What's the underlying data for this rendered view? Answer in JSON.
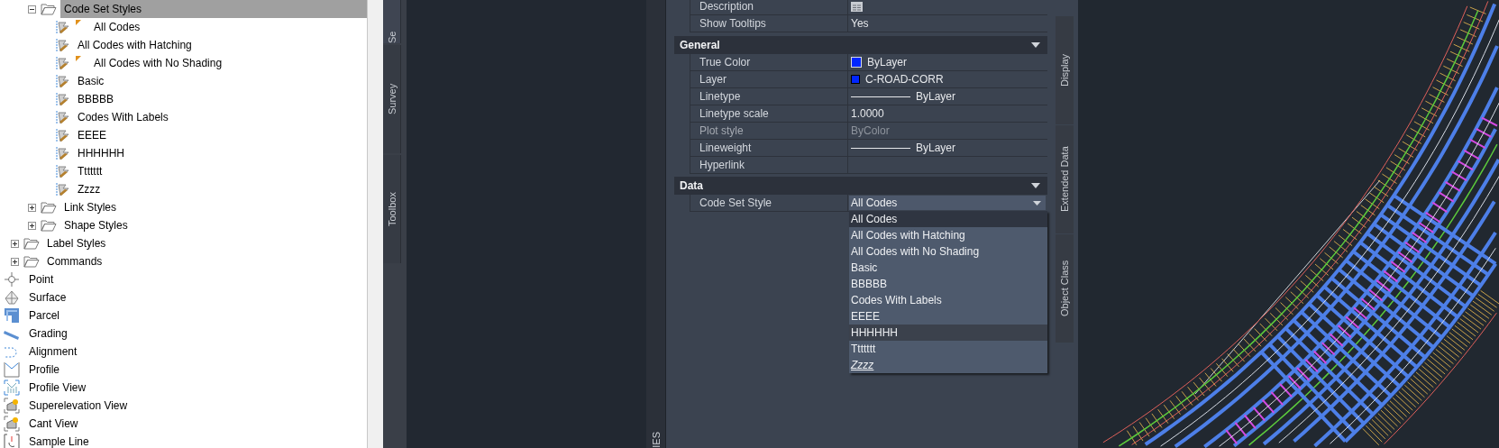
{
  "tree": [
    {
      "children": [
        {
          "children": [
            {
              "label": "Code Set Styles",
              "kind": "folder",
              "expanded": true,
              "selected": true,
              "children": [
                {
                  "label": "All Codes",
                  "kind": "style",
                  "flagged": true,
                  "selected": false
                },
                {
                  "label": "All Codes with Hatching",
                  "kind": "style",
                  "flagged": false,
                  "selected": false
                },
                {
                  "label": "All Codes with No Shading",
                  "kind": "style",
                  "flagged": true,
                  "selected": false
                },
                {
                  "label": "Basic",
                  "kind": "style",
                  "flagged": false,
                  "selected": false
                },
                {
                  "label": "BBBBB",
                  "kind": "style",
                  "flagged": false,
                  "selected": false
                },
                {
                  "label": "Codes With Labels",
                  "kind": "style",
                  "flagged": false,
                  "selected": false
                },
                {
                  "label": "EEEE",
                  "kind": "style",
                  "flagged": false,
                  "selected": false
                },
                {
                  "label": "HHHHHH",
                  "kind": "style",
                  "flagged": false,
                  "selected": false
                },
                {
                  "label": "Ttttttt",
                  "kind": "style",
                  "flagged": false,
                  "selected": false
                },
                {
                  "label": "Zzzz",
                  "kind": "style",
                  "flagged": false,
                  "selected": false
                }
              ]
            },
            {
              "label": "Link Styles",
              "kind": "folder",
              "expanded": false,
              "selected": false
            },
            {
              "label": "Shape Styles",
              "kind": "folder",
              "expanded": false,
              "selected": false
            }
          ]
        },
        {
          "label": "Label Styles",
          "kind": "folder",
          "expanded": false,
          "selected": false
        },
        {
          "label": "Commands",
          "kind": "folder",
          "expanded": false,
          "selected": false
        }
      ]
    },
    {
      "label": "Point",
      "kind": "object",
      "selected": false
    },
    {
      "label": "Surface",
      "kind": "object",
      "selected": false
    },
    {
      "label": "Parcel",
      "kind": "object",
      "selected": false
    },
    {
      "label": "Grading",
      "kind": "object",
      "selected": false
    },
    {
      "label": "Alignment",
      "kind": "object",
      "selected": false
    },
    {
      "label": "Profile",
      "kind": "object",
      "selected": false
    },
    {
      "label": "Profile View",
      "kind": "object",
      "selected": false
    },
    {
      "label": "Superelevation View",
      "kind": "object",
      "selected": false
    },
    {
      "label": "Cant View",
      "kind": "object",
      "selected": false
    },
    {
      "label": "Sample Line",
      "kind": "object",
      "selected": false
    }
  ],
  "left_tabs": [
    {
      "label": "Se",
      "selected": true
    },
    {
      "label": "Survey",
      "selected": false
    },
    {
      "label": "Toolbox",
      "selected": false
    }
  ],
  "palette_title": "IES",
  "properties": {
    "rows": [
      {
        "label": "Description",
        "kind": "editor",
        "disabled": false
      },
      {
        "label": "Show Tooltips",
        "kind": "text",
        "value": "Yes",
        "disabled": false
      }
    ],
    "sections": [
      {
        "title": "General",
        "expanded": true,
        "rows": [
          {
            "label": "True Color",
            "kind": "color",
            "color": "#0026ff",
            "value": "ByLayer",
            "disabled": false
          },
          {
            "label": "Layer",
            "kind": "layer",
            "color": "#0026ff",
            "value": "C-ROAD-CORR",
            "disabled": false
          },
          {
            "label": "Linetype",
            "kind": "line",
            "value": "ByLayer",
            "disabled": false
          },
          {
            "label": "Linetype scale",
            "kind": "text",
            "value": "1.0000",
            "disabled": false
          },
          {
            "label": "Plot style",
            "kind": "text",
            "value": "ByColor",
            "disabled": true
          },
          {
            "label": "Lineweight",
            "kind": "line",
            "value": "ByLayer",
            "disabled": false
          },
          {
            "label": "Hyperlink",
            "kind": "text",
            "disabled": false
          }
        ]
      },
      {
        "title": "Data",
        "expanded": true,
        "rows": [
          {
            "label": "Code Set Style",
            "kind": "dropdown",
            "value": "All Codes",
            "expanded": true,
            "disabled": false,
            "options": [
              {
                "label": "All Codes",
                "selected": true,
                "hovered": false,
                "underlined": false
              },
              {
                "label": "All Codes with Hatching",
                "selected": false,
                "hovered": false,
                "underlined": false
              },
              {
                "label": "All Codes with No Shading",
                "selected": false,
                "hovered": false,
                "underlined": false
              },
              {
                "label": "Basic",
                "selected": false,
                "hovered": false,
                "underlined": false
              },
              {
                "label": "BBBBB",
                "selected": false,
                "hovered": false,
                "underlined": false
              },
              {
                "label": "Codes With Labels",
                "selected": false,
                "hovered": false,
                "underlined": false
              },
              {
                "label": "EEEE",
                "selected": false,
                "hovered": false,
                "underlined": false
              },
              {
                "label": "HHHHHH",
                "selected": false,
                "hovered": true,
                "underlined": false
              },
              {
                "label": "Ttttttt",
                "selected": false,
                "hovered": false,
                "underlined": false
              },
              {
                "label": "Zzzz",
                "selected": false,
                "hovered": false,
                "underlined": true
              }
            ]
          }
        ]
      }
    ]
  },
  "right_tabs": [
    {
      "label": "Display"
    },
    {
      "label": "Extended Data"
    },
    {
      "label": "Object Class"
    }
  ]
}
